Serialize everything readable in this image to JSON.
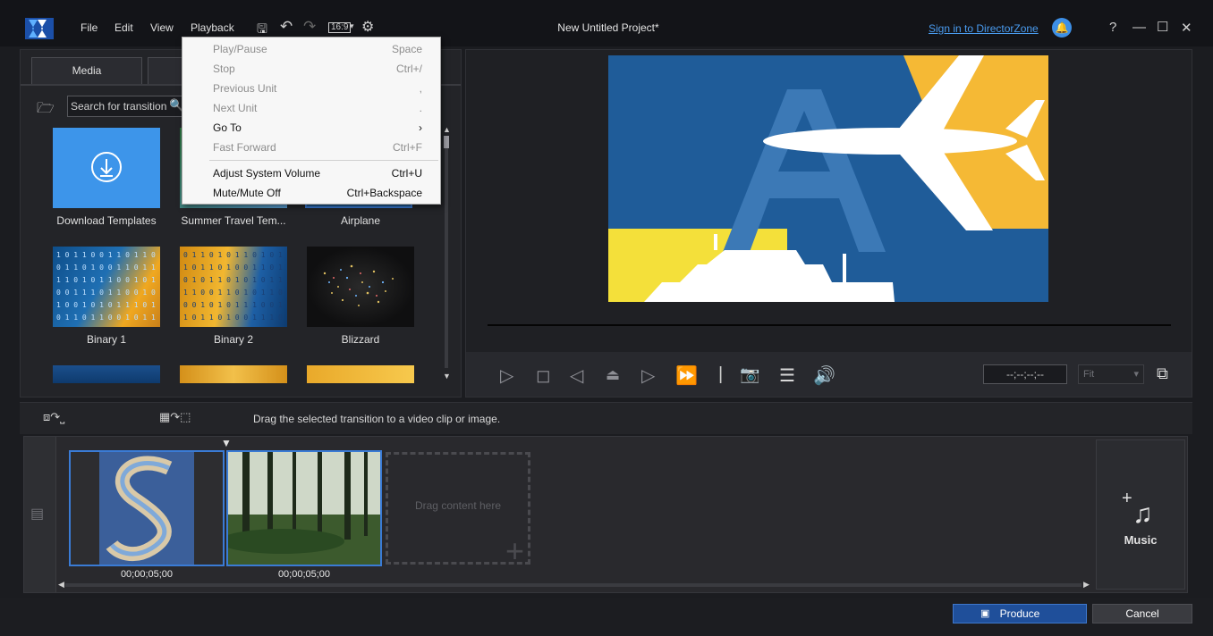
{
  "menubar": {
    "items": [
      "File",
      "Edit",
      "View",
      "Playback"
    ],
    "aspect_ratio": "16:9"
  },
  "window": {
    "title": "New Untitled Project*",
    "sign_in": "Sign in to DirectorZone"
  },
  "library": {
    "tabs": [
      "Media"
    ],
    "search_placeholder": "Search for transition",
    "items": [
      {
        "label": "Download Templates"
      },
      {
        "label": "Summer Travel Tem..."
      },
      {
        "label": "Airplane"
      },
      {
        "label": "Binary 1"
      },
      {
        "label": "Binary 2"
      },
      {
        "label": "Blizzard"
      }
    ]
  },
  "preview": {
    "timecode": "--;--;--;--",
    "fit": "Fit"
  },
  "editor": {
    "hint": "Drag the selected transition to a video clip or image."
  },
  "storyboard": {
    "clips": [
      {
        "duration": "00;00;05;00"
      },
      {
        "duration": "00;00;05;00"
      }
    ],
    "drop_text": "Drag content here",
    "music_label": "Music"
  },
  "footer": {
    "produce": "Produce",
    "cancel": "Cancel"
  },
  "playback_menu": [
    {
      "label": "Play/Pause",
      "shortcut": "Space",
      "enabled": false
    },
    {
      "label": "Stop",
      "shortcut": "Ctrl+/",
      "enabled": false
    },
    {
      "label": "Previous Unit",
      "shortcut": ",",
      "enabled": false
    },
    {
      "label": "Next Unit",
      "shortcut": ".",
      "enabled": false
    },
    {
      "label": "Go To",
      "shortcut": "›",
      "enabled": true
    },
    {
      "label": "Fast Forward",
      "shortcut": "Ctrl+F",
      "enabled": false
    },
    {
      "label": "Adjust System Volume",
      "shortcut": "Ctrl+U",
      "enabled": true
    },
    {
      "label": "Mute/Mute Off",
      "shortcut": "Ctrl+Backspace",
      "enabled": true
    }
  ],
  "colors": {
    "accent": "#3a7bd5",
    "link": "#4a9cf0",
    "produce": "#1f4f9a"
  }
}
